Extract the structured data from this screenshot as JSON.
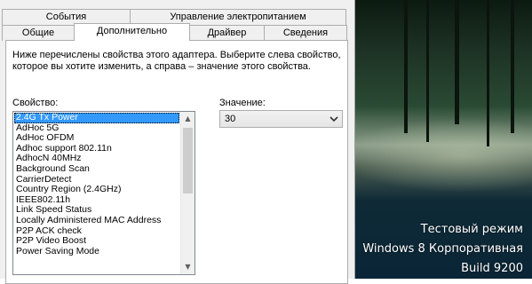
{
  "tabs_row1": [
    "События",
    "Управление электропитанием"
  ],
  "tabs_row2": [
    "Общие",
    "Дополнительно",
    "Драйвер",
    "Сведения"
  ],
  "active_tab": "Дополнительно",
  "description": "Ниже перечислены свойства этого адаптера. Выберите слева свойство, которое вы хотите изменить, а справа – значение этого свойства.",
  "property_label": "Свойство:",
  "value_label": "Значение:",
  "properties": [
    "2.4G Tx Power",
    "AdHoc 5G",
    "AdHoc OFDM",
    "Adhoc support 802.11n",
    "AdhocN 40MHz",
    "Background Scan",
    "CarrierDetect",
    "Country Region (2.4GHz)",
    "IEEE802.11h",
    "Link Speed Status",
    "Locally Administered MAC Address",
    "P2P ACK check",
    "P2P Video Boost",
    "Power Saving Mode"
  ],
  "selected_property": "2.4G Tx Power",
  "value": "30",
  "watermark": {
    "line1": "Тестовый режим",
    "line2": "Windows 8 Корпоративная",
    "line3": "Build 9200"
  },
  "icons": {
    "scroll_up": "▲",
    "scroll_down": "▼",
    "dropdown": "chevron-down-icon"
  }
}
